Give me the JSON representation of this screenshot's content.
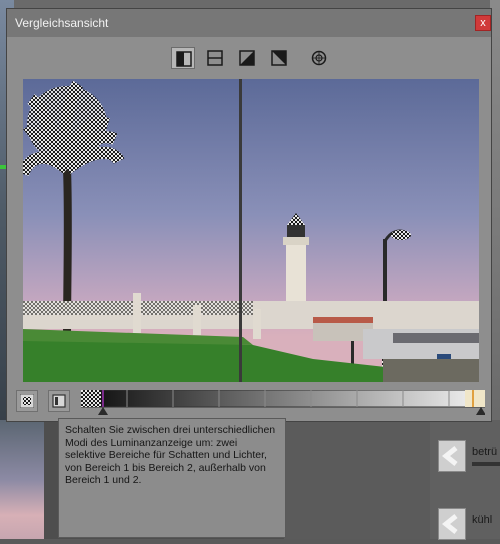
{
  "dialog": {
    "title": "Vergleichsansicht",
    "close_label": "x"
  },
  "toolbar": {
    "modes": [
      {
        "icon": "split-vertical-icon",
        "active": true
      },
      {
        "icon": "split-horizontal-icon",
        "active": false
      },
      {
        "icon": "split-diagonal-left-icon",
        "active": false
      },
      {
        "icon": "split-diagonal-right-icon",
        "active": false
      },
      {
        "icon": "focus-target-icon",
        "active": false
      }
    ]
  },
  "viewer": {
    "split_divider_icon": "vertical-divider"
  },
  "luminance": {
    "buttons": [
      {
        "icon": "luminance-overlay-icon"
      },
      {
        "icon": "luminance-mode-icon"
      }
    ],
    "slider_left_level": 0.05,
    "slider_right_level": 1.0
  },
  "tooltip": {
    "text": "Schalten Sie zwischen drei unterschiedlichen Modi des Luminanzanzeige um: zwei selektive Bereiche für Schatten und Lichter, von Bereich 1 bis Bereich 2, außerhalb von Bereich 1 und 2."
  },
  "right_panel": {
    "items": [
      {
        "label": "betrü"
      },
      {
        "label": "kühl"
      }
    ]
  },
  "colors": {
    "close_button": "#d03a3a",
    "highlight_marker": "#e0a040",
    "shadow_marker": "#7a2a8a"
  }
}
